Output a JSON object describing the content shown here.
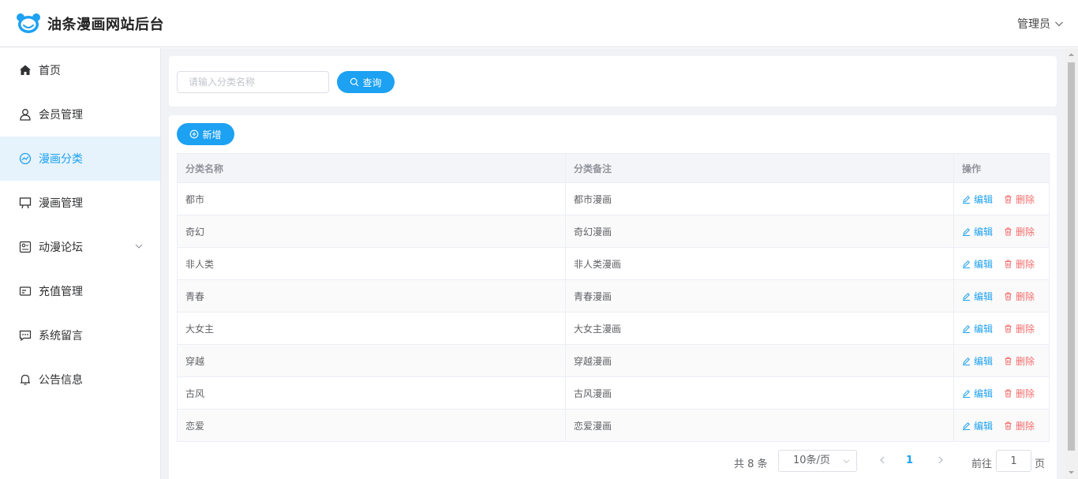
{
  "header": {
    "logo_icon": "bear-face-icon",
    "title": "油条漫画网站后台",
    "user_label": "管理员",
    "accent_color": "#1da1f2"
  },
  "sidebar": {
    "items": [
      {
        "label": "首页",
        "icon": "home-icon"
      },
      {
        "label": "会员管理",
        "icon": "user-icon"
      },
      {
        "label": "漫画分类",
        "icon": "chart-icon",
        "active": true
      },
      {
        "label": "漫画管理",
        "icon": "easel-icon"
      },
      {
        "label": "动漫论坛",
        "icon": "forum-icon",
        "has_submenu": true
      },
      {
        "label": "充值管理",
        "icon": "card-icon"
      },
      {
        "label": "系统留言",
        "icon": "message-icon"
      },
      {
        "label": "公告信息",
        "icon": "bell-icon"
      }
    ]
  },
  "search": {
    "placeholder": "请输入分类名称",
    "value": "",
    "button_label": "查询"
  },
  "toolbar": {
    "add_label": "新增"
  },
  "table": {
    "columns": [
      "分类名称",
      "分类备注",
      "操作"
    ],
    "rows": [
      {
        "name": "都市",
        "note": "都市漫画"
      },
      {
        "name": "奇幻",
        "note": "奇幻漫画"
      },
      {
        "name": "非人类",
        "note": "非人类漫画"
      },
      {
        "name": "青春",
        "note": "青春漫画"
      },
      {
        "name": "大女主",
        "note": "大女主漫画"
      },
      {
        "name": "穿越",
        "note": "穿越漫画"
      },
      {
        "name": "古风",
        "note": "古风漫画"
      },
      {
        "name": "恋爱",
        "note": "恋爱漫画"
      }
    ],
    "edit_label": "编辑",
    "delete_label": "删除"
  },
  "pagination": {
    "total_text": "共 8 条",
    "page_size": "10条/页",
    "current_page": "1",
    "goto_label": "前往",
    "goto_value": "1",
    "goto_suffix": "页"
  }
}
